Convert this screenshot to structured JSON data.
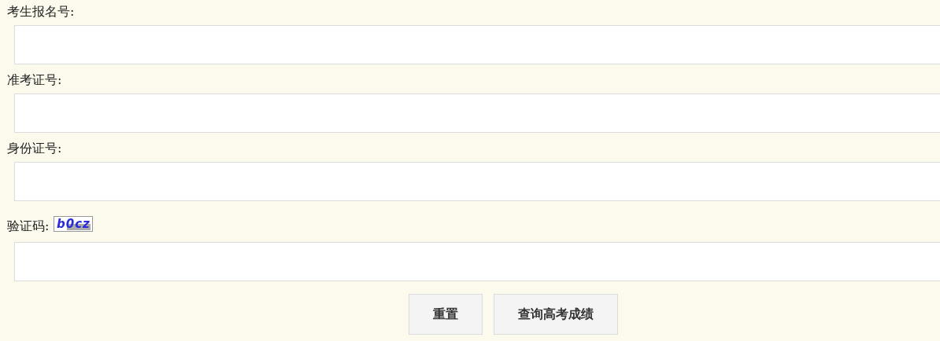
{
  "fields": [
    {
      "kind": "text",
      "label": "考生报名号:"
    },
    {
      "kind": "text",
      "label": "准考证号:"
    },
    {
      "kind": "text",
      "label": "身份证号:"
    },
    {
      "kind": "captcha",
      "label": "验证码:",
      "captcha": "b0cz"
    }
  ],
  "buttons": [
    "重置",
    "查询高考成绩"
  ]
}
